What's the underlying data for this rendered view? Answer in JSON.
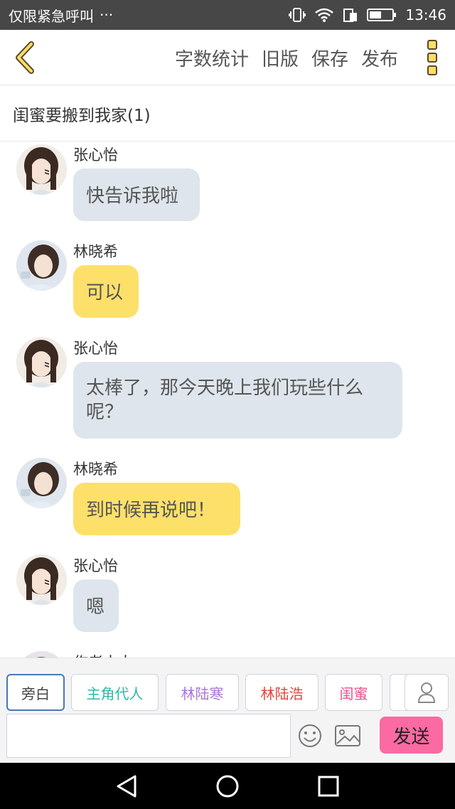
{
  "status_bar": {
    "notification_text": "仅限紧急呼叫",
    "overflow": "···",
    "time": "13:46"
  },
  "top_nav": {
    "actions": [
      "字数统计",
      "旧版",
      "保存",
      "发布"
    ]
  },
  "chat": {
    "title": "闺蜜要搬到我家(1)",
    "messages": [
      {
        "sender": "张心怡",
        "text": "快告诉我啦"
      },
      {
        "sender": "林晓希",
        "text": "可以"
      },
      {
        "sender": "张心怡",
        "text": "太棒了，那今天晚上我们玩些什么呢？"
      },
      {
        "sender": "林晓希",
        "text": "到时候再说吧！"
      },
      {
        "sender": "张心怡",
        "text": "嗯"
      },
      {
        "sender": "作者大大",
        "text": ""
      }
    ]
  },
  "roles": [
    {
      "label": "旁白",
      "color": "#444444"
    },
    {
      "label": "主角代人",
      "color": "#2fb8a6"
    },
    {
      "label": "林陆寒",
      "color": "#a876d6"
    },
    {
      "label": "林陆浩",
      "color": "#e0463a"
    },
    {
      "label": "闺蜜",
      "color": "#ee4f8c"
    }
  ],
  "composer": {
    "placeholder": "",
    "send_label": "发送"
  },
  "colors": {
    "accent_yellow": "#fde06a",
    "bubble_gray": "#dfe5ec",
    "send_pink": "#fb6aa2"
  }
}
